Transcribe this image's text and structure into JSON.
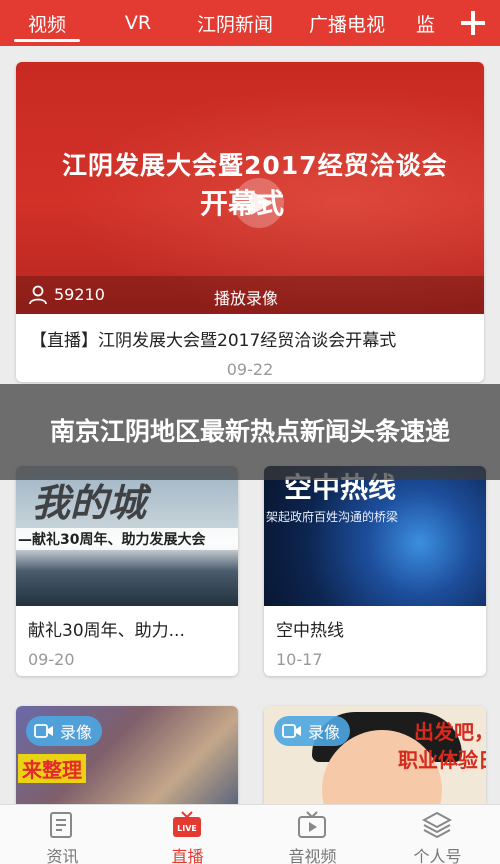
{
  "tabs": [
    {
      "label": "视频",
      "active": true
    },
    {
      "label": "VR",
      "active": false
    },
    {
      "label": "江阴新闻",
      "active": false
    },
    {
      "label": "广播电视",
      "active": false
    },
    {
      "label": "监",
      "active": false
    }
  ],
  "feature": {
    "image_title_line1": "江阴发展大会暨2017经贸洽谈会",
    "image_title_line2": "开幕式",
    "viewer_count": "59210",
    "replay_label": "播放录像",
    "title": "【直播】江阴发展大会暨2017经贸洽谈会开幕式",
    "date": "09-22"
  },
  "banner": {
    "text": "南京江阴地区最新热点新闻头条速递"
  },
  "cards": [
    {
      "image_text_script": "我的城",
      "image_text_strip": "—献礼30周年、助力发展大会",
      "title": "献礼30周年、助力...",
      "date": "09-20"
    },
    {
      "image_text_title": "空中热线",
      "image_text_sub": "架起政府百姓沟通的桥梁",
      "title": "空中热线",
      "date": "10-17"
    },
    {
      "badge": "录像",
      "image_text": "来整理"
    },
    {
      "badge": "录像",
      "image_text_a": "出发吧，小伙",
      "image_text_b": "职业体验日"
    }
  ],
  "bottom_nav": [
    {
      "label": "资讯",
      "icon": "news-icon",
      "active": false
    },
    {
      "label": "直播",
      "icon": "live-icon",
      "active": true
    },
    {
      "label": "音视频",
      "icon": "media-icon",
      "active": false
    },
    {
      "label": "个人号",
      "icon": "layers-icon",
      "active": false
    }
  ],
  "colors": {
    "brand_red": "#e33a32",
    "badge_blue": "#4da6e2"
  }
}
